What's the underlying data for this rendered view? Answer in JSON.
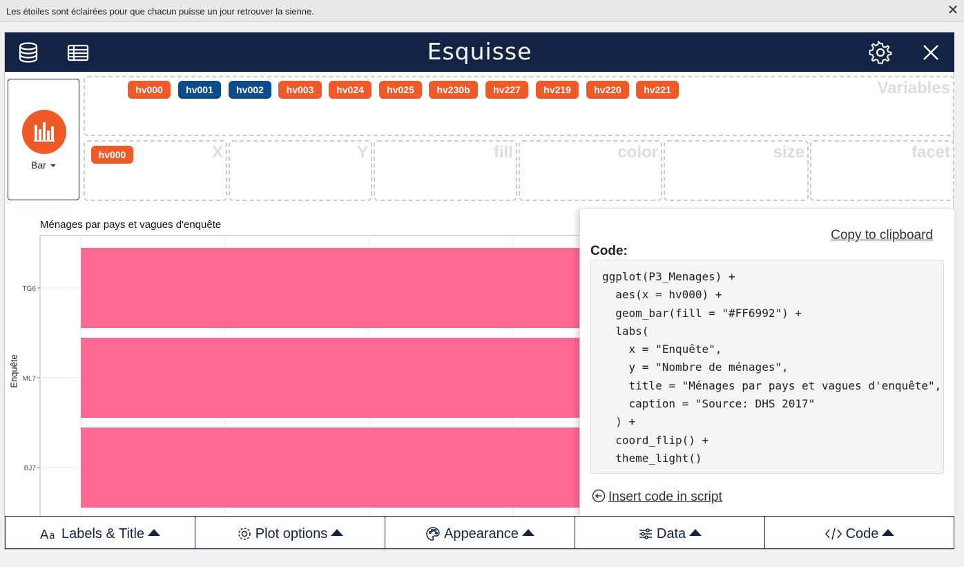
{
  "notification": {
    "message": "Les étoiles sont éclairées pour que chacun puisse un jour retrouver la sienne.",
    "close_label": "✕"
  },
  "header": {
    "title": "Esquisse",
    "left_icons": [
      "database-icon",
      "table-icon"
    ],
    "right_icons": [
      "gear-icon",
      "close-icon"
    ]
  },
  "geom": {
    "label": "Bar",
    "icon": "bar-chart-icon",
    "color": "#f05a28"
  },
  "variables": {
    "zone_label": "Variables",
    "items": [
      {
        "name": "hv000",
        "color": "#f05a28"
      },
      {
        "name": "hv001",
        "color": "#0c4c8a"
      },
      {
        "name": "hv002",
        "color": "#0c4c8a"
      },
      {
        "name": "hv003",
        "color": "#f05a28"
      },
      {
        "name": "hv024",
        "color": "#f05a28"
      },
      {
        "name": "hv025",
        "color": "#f05a28"
      },
      {
        "name": "hv230b",
        "color": "#f05a28"
      },
      {
        "name": "hv227",
        "color": "#f05a28"
      },
      {
        "name": "hv219",
        "color": "#f05a28"
      },
      {
        "name": "hv220",
        "color": "#f05a28"
      },
      {
        "name": "hv221",
        "color": "#f05a28"
      }
    ]
  },
  "aes_zones": [
    {
      "label": "X",
      "assigned": "hv000"
    },
    {
      "label": "Y",
      "assigned": ""
    },
    {
      "label": "fill",
      "assigned": ""
    },
    {
      "label": "color",
      "assigned": ""
    },
    {
      "label": "size",
      "assigned": ""
    },
    {
      "label": "facet",
      "assigned": ""
    }
  ],
  "chart_data": {
    "type": "bar",
    "orientation": "horizontal",
    "title": "Ménages par pays et vagues d'enquête",
    "ylabel": "Enquête",
    "categories": [
      "TG6",
      "ML7",
      "BJ7"
    ],
    "bar_color": "#FF6992",
    "grid": true,
    "note": "bar lengths partially hidden behind code panel"
  },
  "code_panel": {
    "copy_label": "Copy to clipboard",
    "code_label": "Code:",
    "code": "ggplot(P3_Menages) +\n  aes(x = hv000) +\n  geom_bar(fill = \"#FF6992\") +\n  labs(\n    x = \"Enquête\",\n    y = \"Nombre de ménages\",\n    title = \"Ménages par pays et vagues d'enquête\",\n    caption = \"Source: DHS 2017\"\n  ) +\n  coord_flip() +\n  theme_light()",
    "insert_label": "Insert code in script"
  },
  "footer_tabs": [
    {
      "label": "Labels & Title",
      "icon": "font-icon"
    },
    {
      "label": "Plot options",
      "icon": "gear-icon"
    },
    {
      "label": "Appearance",
      "icon": "palette-icon"
    },
    {
      "label": "Data",
      "icon": "sliders-icon"
    },
    {
      "label": "Code",
      "icon": "code-icon"
    }
  ]
}
